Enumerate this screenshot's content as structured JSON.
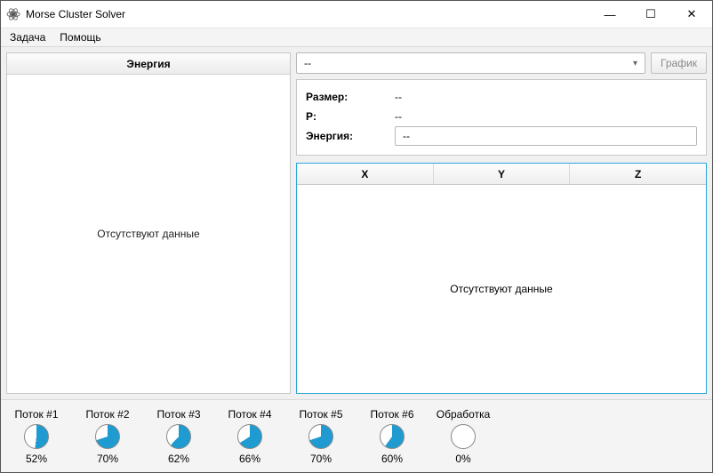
{
  "window": {
    "title": "Morse Cluster Solver",
    "minimize_icon": "—",
    "maximize_icon": "☐",
    "close_icon": "✕"
  },
  "menu": {
    "task": "Задача",
    "help": "Помощь"
  },
  "left": {
    "header": "Энергия",
    "empty": "Отсутствуют данные"
  },
  "right": {
    "combo_value": "--",
    "graph_button": "График",
    "info": {
      "size_label": "Размер:",
      "size_value": "--",
      "p_label": "P:",
      "p_value": "--",
      "energy_label": "Энергия:",
      "energy_value": "--"
    },
    "table": {
      "cols": {
        "x": "X",
        "y": "Y",
        "z": "Z"
      },
      "empty": "Отсутствуют данные"
    }
  },
  "threads": [
    {
      "label": "Поток #1",
      "percent": 52,
      "text": "52%"
    },
    {
      "label": "Поток #2",
      "percent": 70,
      "text": "70%"
    },
    {
      "label": "Поток #3",
      "percent": 62,
      "text": "62%"
    },
    {
      "label": "Поток #4",
      "percent": 66,
      "text": "66%"
    },
    {
      "label": "Поток #5",
      "percent": 70,
      "text": "70%"
    },
    {
      "label": "Поток #6",
      "percent": 60,
      "text": "60%"
    },
    {
      "label": "Обработка",
      "percent": 0,
      "text": "0%"
    }
  ],
  "colors": {
    "accent": "#2aa6d8",
    "pie_fill": "#1f9bd1"
  }
}
